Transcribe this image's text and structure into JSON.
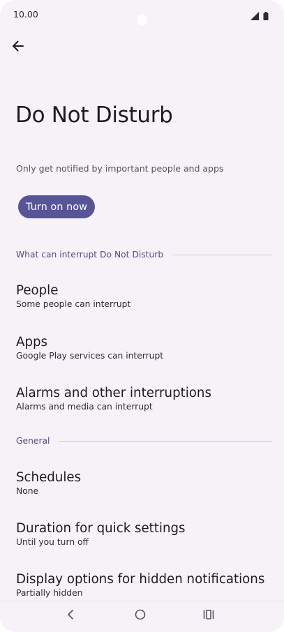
{
  "status_bar": {
    "time": "10.00",
    "icons": [
      "signal-icon",
      "battery-icon"
    ]
  },
  "header": {
    "back_icon": "arrow-left-icon"
  },
  "page": {
    "title": "Do Not Disturb",
    "subtitle": "Only get notified by important people and apps",
    "turn_on_label": "Turn on now"
  },
  "sections": {
    "interrupt_header": "What can interrupt Do Not Disturb",
    "general_header": "General"
  },
  "items": {
    "people": {
      "title": "People",
      "summary": "Some people can interrupt"
    },
    "apps": {
      "title": "Apps",
      "summary": "Google Play services can interrupt"
    },
    "alarms": {
      "title": "Alarms and other interruptions",
      "summary": "Alarms and media can interrupt"
    },
    "schedules": {
      "title": "Schedules",
      "summary": "None"
    },
    "duration": {
      "title": "Duration for quick settings",
      "summary": "Until you turn off"
    },
    "display": {
      "title": "Display options for hidden notifications",
      "summary": "Partially hidden"
    }
  },
  "nav_bar": {
    "icons": [
      "back-nav-icon",
      "home-nav-icon",
      "recents-nav-icon"
    ]
  },
  "colors": {
    "accent": "#575497",
    "section_text": "#4f4c8e",
    "background": "#f6f2f8"
  }
}
